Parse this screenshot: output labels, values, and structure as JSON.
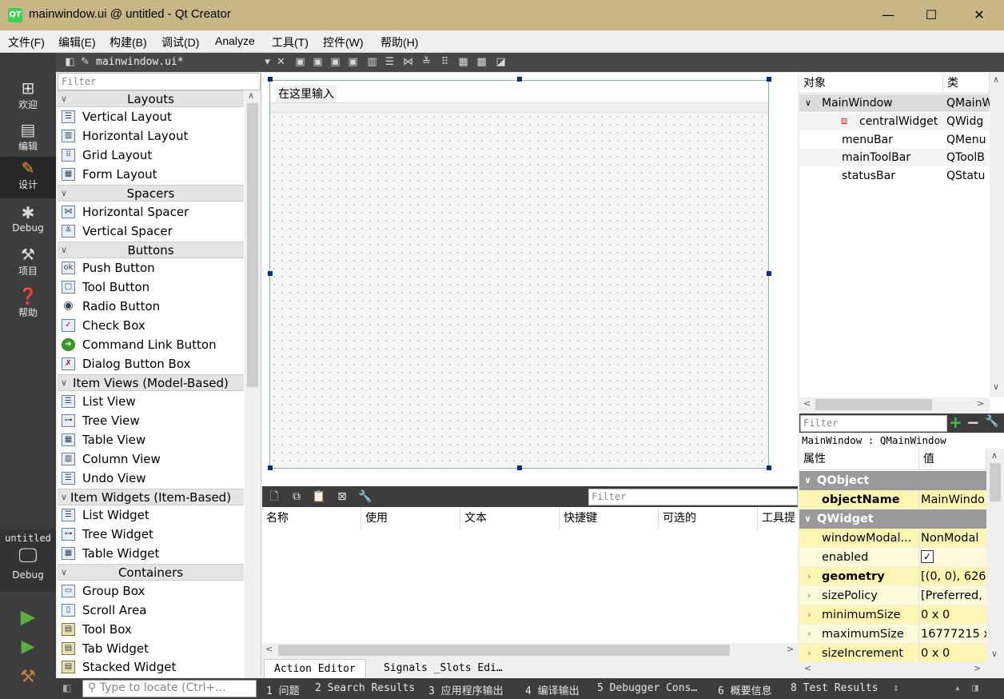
{
  "window": {
    "title": "mainwindow.ui @ untitled - Qt Creator",
    "app_icon": "QT",
    "minimize": "—",
    "maximize": "☐",
    "close": "✕"
  },
  "menu": [
    "文件(F)",
    "编辑(E)",
    "构建(B)",
    "调试(D)",
    "Analyze",
    "工具(T)",
    "控件(W)",
    "帮助(H)"
  ],
  "modes": {
    "welcome": "欢迎",
    "edit": "编辑",
    "design": "设计",
    "debug": "Debug",
    "projects": "项目",
    "help": "帮助",
    "project_name": "untitled",
    "target": "Debug"
  },
  "doc": {
    "filename": "mainwindow.ui*"
  },
  "widgetbox": {
    "filter_placeholder": "Filter",
    "cat_layouts": "Layouts",
    "vertical_layout": "Vertical Layout",
    "horizontal_layout": "Horizontal Layout",
    "grid_layout": "Grid Layout",
    "form_layout": "Form Layout",
    "cat_spacers": "Spacers",
    "horizontal_spacer": "Horizontal Spacer",
    "vertical_spacer": "Vertical Spacer",
    "cat_buttons": "Buttons",
    "push_button": "Push Button",
    "tool_button": "Tool Button",
    "radio_button": "Radio Button",
    "check_box": "Check Box",
    "command_link": "Command Link Button",
    "dialog_button_box": "Dialog Button Box",
    "cat_item_views": "Item Views (Model-Based)",
    "list_view": "List View",
    "tree_view": "Tree View",
    "table_view": "Table View",
    "column_view": "Column View",
    "undo_view": "Undo View",
    "cat_item_widgets": "Item Widgets (Item-Based)",
    "list_widget": "List Widget",
    "tree_widget": "Tree Widget",
    "table_widget": "Table Widget",
    "cat_containers": "Containers",
    "group_box": "Group Box",
    "scroll_area": "Scroll Area",
    "tool_box": "Tool Box",
    "tab_widget": "Tab Widget",
    "stacked_widget": "Stacked Widget"
  },
  "form": {
    "menu_placeholder": "在这里输入"
  },
  "action_editor": {
    "filter_placeholder": "Filter",
    "col_name": "名称",
    "col_used": "使用",
    "col_text": "文本",
    "col_shortcut": "快捷键",
    "col_checkable": "可选的",
    "col_tooltip": "工具提",
    "tab_action": "Action Editor",
    "tab_signals": "Signals _Slots Edi…"
  },
  "object_inspector": {
    "col_object": "对象",
    "col_class": "类",
    "rows": [
      {
        "name": "MainWindow",
        "cls": "QMainW"
      },
      {
        "name": "centralWidget",
        "cls": "QWidg"
      },
      {
        "name": "menuBar",
        "cls": "QMenu"
      },
      {
        "name": "mainToolBar",
        "cls": "QToolB"
      },
      {
        "name": "statusBar",
        "cls": "QStatu"
      }
    ]
  },
  "property_editor": {
    "filter_placeholder": "Filter",
    "class_line": "MainWindow : QMainWindow",
    "col_property": "属性",
    "col_value": "值",
    "sec_qobject": "QObject",
    "sec_qwidget": "QWidget",
    "rows": [
      {
        "name": "objectName",
        "value": "MainWindo"
      },
      {
        "name": "windowModal...",
        "value": "NonModal"
      },
      {
        "name": "enabled",
        "value": "✓"
      },
      {
        "name": "geometry",
        "value": "[(0, 0), 626 ×"
      },
      {
        "name": "sizePolicy",
        "value": "[Preferred,"
      },
      {
        "name": "minimumSize",
        "value": "0 x 0"
      },
      {
        "name": "maximumSize",
        "value": "16777215 x"
      },
      {
        "name": "sizeIncrement",
        "value": "0 x 0"
      }
    ]
  },
  "statusbar": {
    "locate_placeholder": "Type to locate (Ctrl+...",
    "items": [
      "1 问题",
      "2 Search Results",
      "3 应用程序输出",
      "4 编译输出",
      "5 Debugger Cons…",
      "6 概要信息",
      "8 Test Results"
    ]
  },
  "colors": {
    "titlebar": "#c9b687",
    "modebar": "#3d3d3d",
    "accent_select": "#003080",
    "section": "#9a9a9a"
  }
}
